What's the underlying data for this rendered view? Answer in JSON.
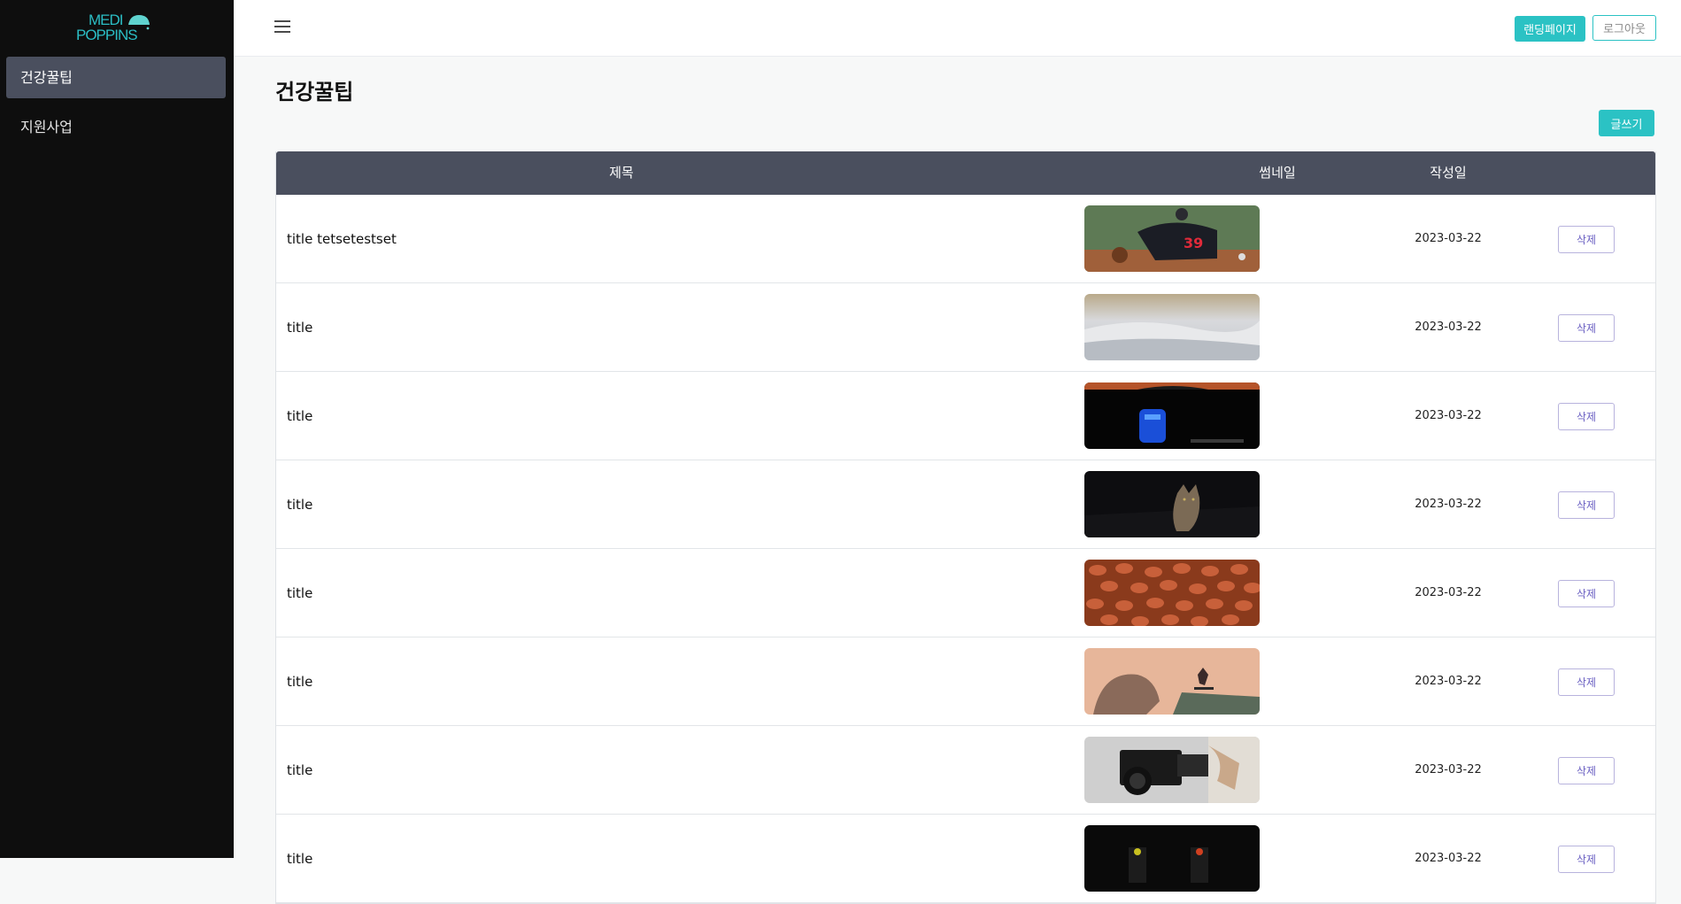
{
  "logo": {
    "line1": "MEDI",
    "line2": "POPPINS"
  },
  "sidebar": {
    "items": [
      {
        "label": "건강꿀팁",
        "active": true
      },
      {
        "label": "지원사업",
        "active": false
      }
    ]
  },
  "header": {
    "landing_label": "랜딩페이지",
    "logout_label": "로그아웃"
  },
  "main": {
    "title": "건강꿀팁",
    "write_label": "글쓰기",
    "table": {
      "columns": [
        "제목",
        "썸네일",
        "작성일"
      ],
      "rows": [
        {
          "title": "title tetsetestset",
          "thumbnail": "baseball-pitcher",
          "date": "2023-03-22",
          "action": "삭제"
        },
        {
          "title": "title",
          "thumbnail": "sand-dunes",
          "date": "2023-03-22",
          "action": "삭제"
        },
        {
          "title": "title",
          "thumbnail": "blue-neon-robot",
          "date": "2023-03-22",
          "action": "삭제"
        },
        {
          "title": "title",
          "thumbnail": "cat-in-dark",
          "date": "2023-03-22",
          "action": "삭제"
        },
        {
          "title": "title",
          "thumbnail": "coffee-beans",
          "date": "2023-03-22",
          "action": "삭제"
        },
        {
          "title": "title",
          "thumbnail": "skateboarder-ramp",
          "date": "2023-03-22",
          "action": "삭제"
        },
        {
          "title": "title",
          "thumbnail": "video-camera",
          "date": "2023-03-22",
          "action": "삭제"
        },
        {
          "title": "title",
          "thumbnail": "dark-objects",
          "date": "2023-03-22",
          "action": "삭제"
        }
      ]
    }
  },
  "colors": {
    "accent": "#2bc2c4",
    "sidebar_bg": "#0e0e0e",
    "sidebar_active": "#4a4f5e",
    "table_header": "#4a4f5e",
    "delete_text": "#6a5fc2"
  }
}
